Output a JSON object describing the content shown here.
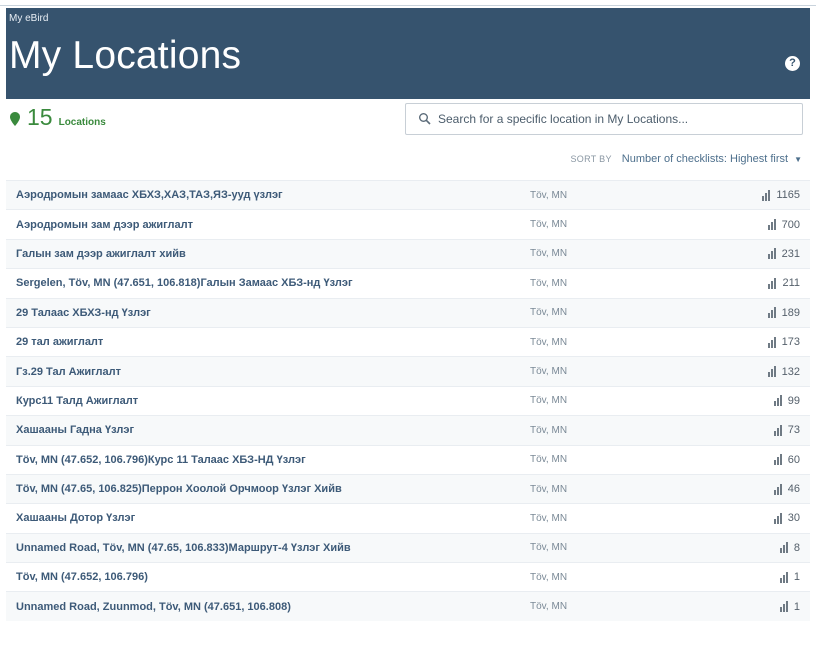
{
  "header": {
    "breadcrumb": "My eBird",
    "title": "My Locations",
    "help_icon": "question-circle-icon"
  },
  "summary": {
    "count": "15",
    "label": "Locations",
    "accent": "#3a8a3d"
  },
  "search": {
    "placeholder": "Search for a specific location in My Locations...",
    "icon": "search-icon"
  },
  "sort": {
    "label": "SORT BY",
    "value": "Number of checklists: Highest first"
  },
  "locations": [
    {
      "name": "Аэродромын замаас ХБХЗ,ХАЗ,ТАЗ,ЯЗ-ууд үзлэг",
      "region": "Töv, MN",
      "checklists": "1165"
    },
    {
      "name": "Аэродромын зам дээр ажиглалт",
      "region": "Töv, MN",
      "checklists": "700"
    },
    {
      "name": "Галын зам дээр ажиглалт хийв",
      "region": "Töv, MN",
      "checklists": "231"
    },
    {
      "name": "Sergelen, Töv, MN (47.651, 106.818)Галын Замаас ХБЗ-нд Үзлэг",
      "region": "Töv, MN",
      "checklists": "211"
    },
    {
      "name": "29 Талаас ХБХЗ-нд Үзлэг",
      "region": "Töv, MN",
      "checklists": "189"
    },
    {
      "name": "29 тал ажиглалт",
      "region": "Töv, MN",
      "checklists": "173"
    },
    {
      "name": "Гз.29 Тал Ажиглалт",
      "region": "Töv, MN",
      "checklists": "132"
    },
    {
      "name": "Курс11 Талд Ажиглалт",
      "region": "Töv, MN",
      "checklists": "99"
    },
    {
      "name": "Хашааны Гадна Үзлэг",
      "region": "Töv, MN",
      "checklists": "73"
    },
    {
      "name": "Töv, MN (47.652, 106.796)Курс 11 Талаас ХБЗ-НД Үзлэг",
      "region": "Töv, MN",
      "checklists": "60"
    },
    {
      "name": "Töv, MN (47.65, 106.825)Перрон Хоолой Орчмоор Үзлэг Хийв",
      "region": "Töv, MN",
      "checklists": "46"
    },
    {
      "name": "Хашааны Дотор Үзлэг",
      "region": "Töv, MN",
      "checklists": "30"
    },
    {
      "name": "Unnamed Road, Töv, MN (47.65, 106.833)Маршрут-4 Үзлэг Хийв",
      "region": "Töv, MN",
      "checklists": "8"
    },
    {
      "name": "Töv, MN (47.652, 106.796)",
      "region": "Töv, MN",
      "checklists": "1"
    },
    {
      "name": "Unnamed Road, Zuunmod, Töv, MN (47.651, 106.808)",
      "region": "Töv, MN",
      "checklists": "1"
    }
  ]
}
